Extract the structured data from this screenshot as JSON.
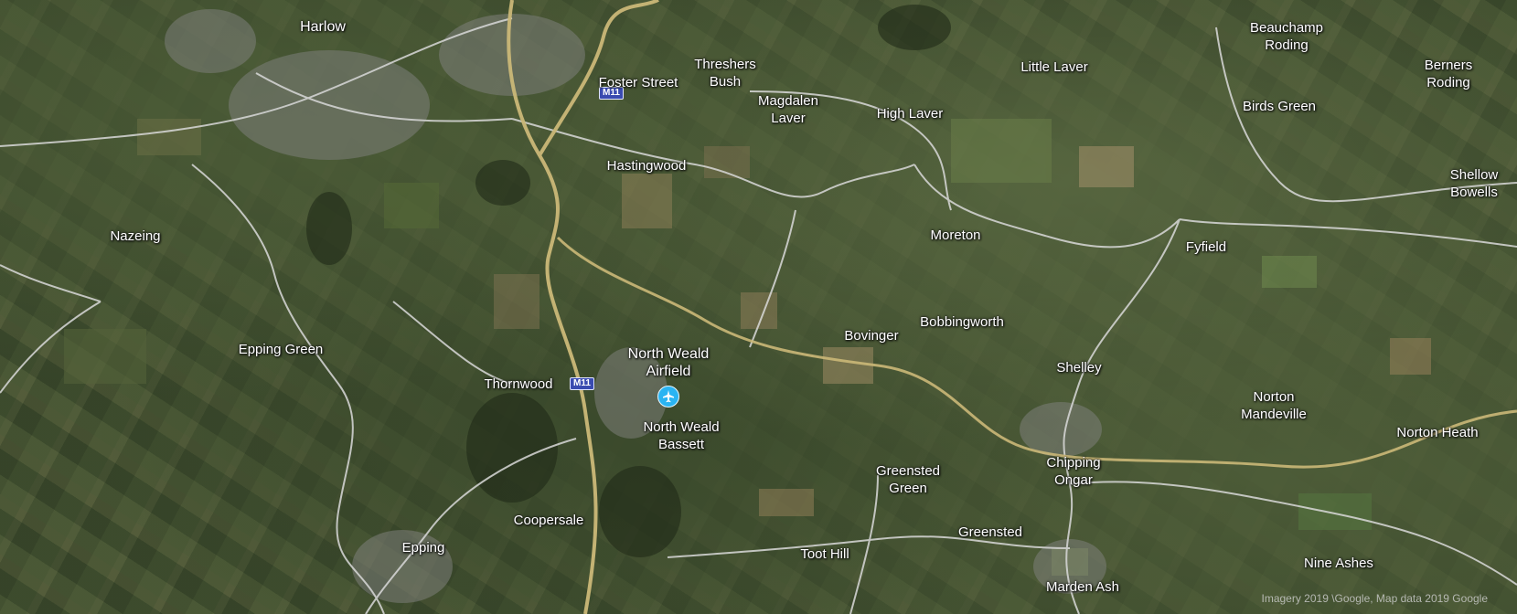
{
  "map": {
    "places": [
      {
        "id": "harlow",
        "lines": [
          "Harlow"
        ]
      },
      {
        "id": "foster-street",
        "lines": [
          "Foster Street"
        ]
      },
      {
        "id": "threshers-bush",
        "lines": [
          "Threshers",
          "Bush"
        ]
      },
      {
        "id": "magdalen-laver",
        "lines": [
          "Magdalen",
          "Laver"
        ]
      },
      {
        "id": "little-laver",
        "lines": [
          "Little Laver"
        ]
      },
      {
        "id": "high-laver",
        "lines": [
          "High Laver"
        ]
      },
      {
        "id": "beauchamp-roding",
        "lines": [
          "Beauchamp",
          "Roding"
        ]
      },
      {
        "id": "berners-roding",
        "lines": [
          "Berners",
          "Roding"
        ]
      },
      {
        "id": "birds-green",
        "lines": [
          "Birds Green"
        ]
      },
      {
        "id": "shellow-bowells",
        "lines": [
          "Shellow",
          "Bowells"
        ]
      },
      {
        "id": "hastingwood",
        "lines": [
          "Hastingwood"
        ]
      },
      {
        "id": "nazeing",
        "lines": [
          "Nazeing"
        ]
      },
      {
        "id": "moreton",
        "lines": [
          "Moreton"
        ]
      },
      {
        "id": "fyfield",
        "lines": [
          "Fyfield"
        ]
      },
      {
        "id": "bobbingworth",
        "lines": [
          "Bobbingworth"
        ]
      },
      {
        "id": "bovinger",
        "lines": [
          "Bovinger"
        ]
      },
      {
        "id": "epping-green",
        "lines": [
          "Epping Green"
        ]
      },
      {
        "id": "north-weald-airfield",
        "lines": [
          "North Weald",
          "Airfield"
        ]
      },
      {
        "id": "shelley",
        "lines": [
          "Shelley"
        ]
      },
      {
        "id": "thornwood",
        "lines": [
          "Thornwood"
        ]
      },
      {
        "id": "norton-mandeville",
        "lines": [
          "Norton",
          "Mandeville"
        ]
      },
      {
        "id": "norton-heath",
        "lines": [
          "Norton Heath"
        ]
      },
      {
        "id": "north-weald-bassett",
        "lines": [
          "North Weald",
          "Bassett"
        ]
      },
      {
        "id": "chipping-ongar",
        "lines": [
          "Chipping",
          "Ongar"
        ]
      },
      {
        "id": "greensted-green",
        "lines": [
          "Greensted",
          "Green"
        ]
      },
      {
        "id": "coopersale",
        "lines": [
          "Coopersale"
        ]
      },
      {
        "id": "greensted",
        "lines": [
          "Greensted"
        ]
      },
      {
        "id": "epping",
        "lines": [
          "Epping"
        ]
      },
      {
        "id": "toot-hill",
        "lines": [
          "Toot Hill"
        ]
      },
      {
        "id": "nine-ashes",
        "lines": [
          "Nine Ashes"
        ]
      },
      {
        "id": "marden-ash",
        "lines": [
          "Marden Ash"
        ]
      }
    ],
    "road_shields": [
      {
        "id": "m11-north",
        "text": "M11"
      },
      {
        "id": "m11-south",
        "text": "M11"
      }
    ],
    "poi": {
      "name": "airport-icon"
    },
    "attribution": "Imagery 2019 \\Google, Map data 2019 Google",
    "colors": {
      "motorway": "#cbb878",
      "road": "#d9d9d9",
      "label": "#ffffff",
      "shield": "#3a4bb0",
      "airport_icon": "#2ab4f2"
    }
  }
}
